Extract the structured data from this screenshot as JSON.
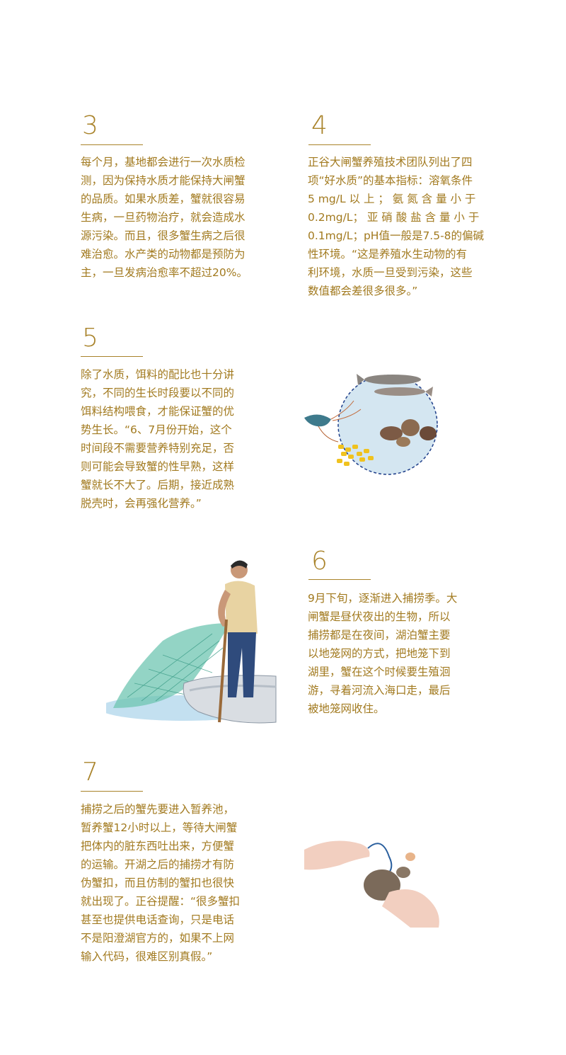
{
  "sections": [
    {
      "number": "3",
      "lines": [
        "每个月，基地都会进行一次水质检",
        "测，因为保持水质才能保持大闸蟹",
        "的品质。如果水质差，蟹就很容易",
        "生病，一旦药物治疗，就会造成水",
        "源污染。而且，很多蟹生病之后很",
        "难治愈。水产类的动物都是预防为",
        "主，一旦发病治愈率不超过20%。"
      ]
    },
    {
      "number": "4",
      "lines": [
        "正谷大闸蟹养殖技术团队列出了四",
        "项“好水质”的基本指标：溶氧条件",
        "5 mg/L 以 上 ；  氨 氮 含 量 小 于",
        "0.2mg/L； 亚 硝 酸 盐 含 量 小 于",
        "0.1mg/L；pH值一般是7.5-8的偏碱",
        "性环境。“这是养殖水生动物的有",
        "利环境，水质一旦受到污染，这些",
        "数值都会差很多很多。”"
      ]
    },
    {
      "number": "5",
      "lines": [
        "除了水质，饵料的配比也十分讲",
        "究，不同的生长时段要以不同的",
        "饵料结构喂食，才能保证蟹的优",
        "势生长。“6、7月份开始，这个",
        "时间段不需要营养特别充足，否",
        "则可能会导致蟹的性早熟，这样",
        "蟹就长不大了。后期，接近成熟",
        "脱壳时，会再强化营养。”"
      ]
    },
    {
      "number": "6",
      "lines": [
        "9月下旬，逐渐进入捕捞季。大",
        "闸蟹是昼伏夜出的生物，所以",
        "捕捞都是在夜间，湖泊蟹主要",
        "以地笼网的方式，把地笼下到",
        "湖里，蟹在这个时候要生殖洄",
        "游，寻着河流入海口走，最后",
        "被地笼网收住。"
      ]
    },
    {
      "number": "7",
      "lines": [
        "捕捞之后的蟹先要进入暂养池，",
        "暂养蟹12小时以上，等待大闸蟹",
        "把体内的脏东西吐出来，方便蟹",
        "的运输。开湖之后的捕捞才有防",
        "伪蟹扣，而且仿制的蟹扣也很快",
        "就出现了。正谷提醒：“很多蟹扣",
        "甚至也提供电话查询，只是电话",
        "不是阳澄湖官方的，如果不上网",
        "输入代码，很难区别真假。”"
      ]
    }
  ],
  "colors": {
    "accent": "#a9832a",
    "text": "#a27a1f"
  },
  "illustrations": [
    "feed-illustration",
    "fisherman-illustration",
    "hands-crab-illustration"
  ]
}
